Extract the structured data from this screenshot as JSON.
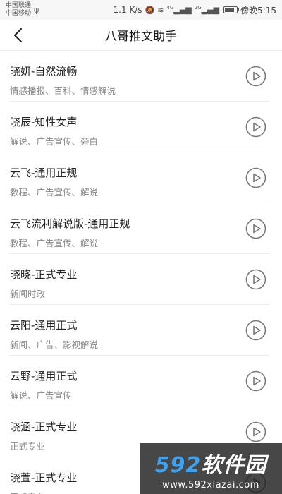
{
  "status_bar": {
    "carrier_1": "中国联通",
    "carrier_2": "中国移动",
    "speed": "1.1 K/s",
    "network_1": "4G",
    "network_2": "2G",
    "time": "傍晚5:15",
    "battery_level": 0.8
  },
  "header": {
    "title": "八哥推文助手"
  },
  "voices": [
    {
      "name": "晓妍-自然流畅",
      "desc": "情感播报、百科、情感解说"
    },
    {
      "name": "晓辰-知性女声",
      "desc": "解说、广告宣传、旁白"
    },
    {
      "name": "云飞-通用正规",
      "desc": "教程、广告宣传、解说"
    },
    {
      "name": "云飞流利解说版-通用正规",
      "desc": "教程、广告宣传、解说"
    },
    {
      "name": "晓晓-正式专业",
      "desc": "新闻时政"
    },
    {
      "name": "云阳-通用正式",
      "desc": "新闻、广告、影视解说"
    },
    {
      "name": "云野-通用正式",
      "desc": "解说、广告宣传"
    },
    {
      "name": "晓涵-正式专业",
      "desc": "正式专业"
    },
    {
      "name": "晓萱-正式专业",
      "desc": "正式专业"
    }
  ],
  "watermark": {
    "logo_num": "592",
    "logo_text": "软件园",
    "url": "www.592xiazai.com"
  },
  "colors": {
    "accent": "#3fa2f0",
    "play_icon": "#777777"
  }
}
